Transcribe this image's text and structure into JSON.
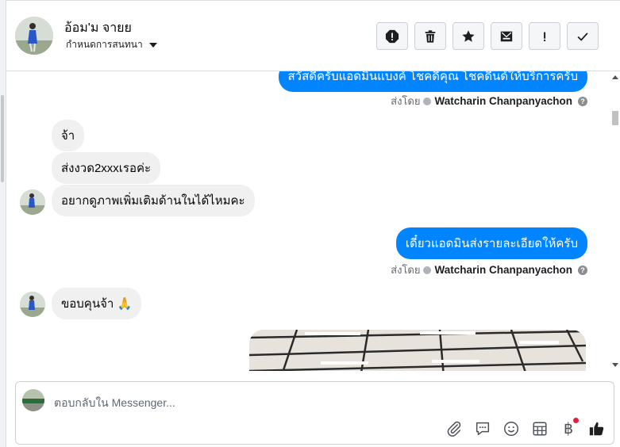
{
  "header": {
    "contact_name": "อ้อม'ม จายย",
    "label_action": "กำหนดการสนทนา",
    "actions": [
      {
        "name": "mark-spam-button",
        "icon": "alert-octagon-icon"
      },
      {
        "name": "delete-button",
        "icon": "trash-icon"
      },
      {
        "name": "star-button",
        "icon": "star-icon"
      },
      {
        "name": "mark-unread-button",
        "icon": "envelope-icon"
      },
      {
        "name": "mark-important-button",
        "icon": "exclamation-icon"
      },
      {
        "name": "mark-done-button",
        "icon": "check-icon"
      }
    ]
  },
  "messages": {
    "outgoing_1": "สวัสดีครับแอดมินแบงค์ โชคดีคุณ โชคดีนด์ให้บริการครับ",
    "sent_by_label": "ส่งโดย",
    "sender_name": "Watcharin Chanpanyachon",
    "incoming_1": "จ้า",
    "incoming_2": "ส่งงวด2xxxเรอค่ะ",
    "incoming_3": "อยากดูภาพเพิ่มเติมด้านในได้ไหมคะ",
    "outgoing_2": "เดี๋ยวแอดมินส่งรายละเอียดให้ครับ",
    "incoming_4": "ขอบคุนจ้า 🙏"
  },
  "composer": {
    "placeholder": "ตอบกลับใน Messenger...",
    "tools": [
      "paperclip-icon",
      "chat-bubble-icon",
      "emoji-icon",
      "calculator-icon",
      "baht-icon",
      "thumbs-up-icon"
    ],
    "baht_symbol": "฿"
  },
  "colors": {
    "outgoing_bubble": "#0084ff",
    "incoming_bubble": "#f0f0f0",
    "notification_dot": "#e41e3f"
  }
}
